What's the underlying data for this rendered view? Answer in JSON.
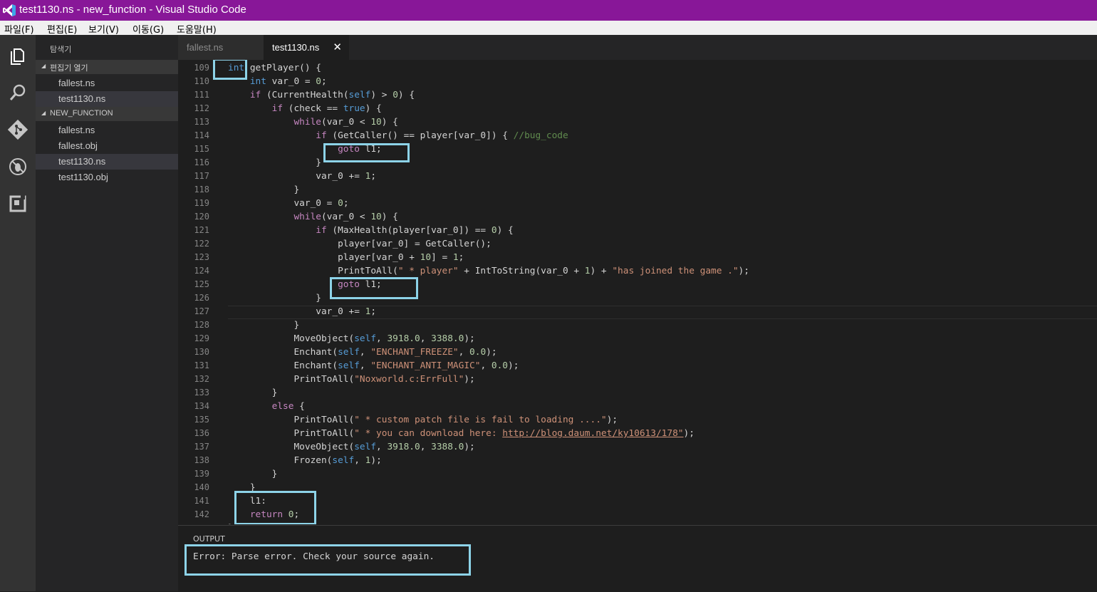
{
  "window": {
    "title": "test1130.ns - new_function - Visual Studio Code"
  },
  "menu": [
    "파일(F)",
    "편집(E)",
    "보기(V)",
    "이동(G)",
    "도움말(H)"
  ],
  "activity_bar": [
    "explorer-icon",
    "search-icon",
    "git-icon",
    "debug-icon",
    "extensions-icon"
  ],
  "explorer": {
    "title": "탐색기",
    "open_editors_label": "편집기 열기",
    "open_editors": [
      "fallest.ns",
      "test1130.ns"
    ],
    "folder_label": "NEW_FUNCTION",
    "files": [
      "fallest.ns",
      "fallest.obj",
      "test1130.ns",
      "test1130.obj"
    ],
    "selected_file": "test1130.ns"
  },
  "tabs": [
    {
      "label": "fallest.ns",
      "active": false
    },
    {
      "label": "test1130.ns",
      "active": true
    }
  ],
  "tab_close_glyph": "✕",
  "code": {
    "line_numbers": [
      "109",
      "110",
      "111",
      "112",
      "113",
      "114",
      "115",
      "116",
      "117",
      "118",
      "119",
      "120",
      "121",
      "122",
      "123",
      "124",
      "125",
      "126",
      "127",
      "128",
      "129",
      "130",
      "131",
      "132",
      "133",
      "134",
      "135",
      "136",
      "137",
      "138",
      "139",
      "140",
      "141",
      "142"
    ],
    "lines": [
      "int getPlayer() {",
      "    int var_0 = 0;",
      "    if (CurrentHealth(self) > 0) {",
      "        if (check == true) {",
      "            while(var_0 < 10) {",
      "                if (GetCaller() == player[var_0]) { //bug_code",
      "                    goto l1;",
      "                }",
      "                var_0 += 1;",
      "            }",
      "            var_0 = 0;",
      "            while(var_0 < 10) {",
      "                if (MaxHealth(player[var_0]) == 0) {",
      "                    player[var_0] = GetCaller();",
      "                    player[var_0 + 10] = 1;",
      "                    PrintToAll(\" * player\" + IntToString(var_0 + 1) + \"has joined the game .\");",
      "                    goto l1;",
      "                }",
      "                var_0 += 1;",
      "            }",
      "            MoveObject(self, 3918.0, 3388.0);",
      "            Enchant(self, \"ENCHANT_FREEZE\", 0.0);",
      "            Enchant(self, \"ENCHANT_ANTI_MAGIC\", 0.0);",
      "            PrintToAll(\"Noxworld.c:ErrFull\");",
      "        }",
      "        else {",
      "            PrintToAll(\" * custom patch file is fail to loading ....\");",
      "            PrintToAll(\" * you can download here: http://blog.daum.net/ky10613/178\");",
      "            MoveObject(self, 3918.0, 3388.0);",
      "            Frozen(self, 1);",
      "        }",
      "    }",
      "    l1:",
      "    return 0;"
    ]
  },
  "output": {
    "title": "OUTPUT",
    "message": "Error: Parse error. Check your source again."
  },
  "colors": {
    "title_bar": "#881798",
    "highlight_box": "#8dd3e8",
    "keyword": "#569cd6",
    "control": "#c586c0",
    "string": "#ce9178",
    "number": "#b5cea8",
    "comment": "#608b4e"
  }
}
